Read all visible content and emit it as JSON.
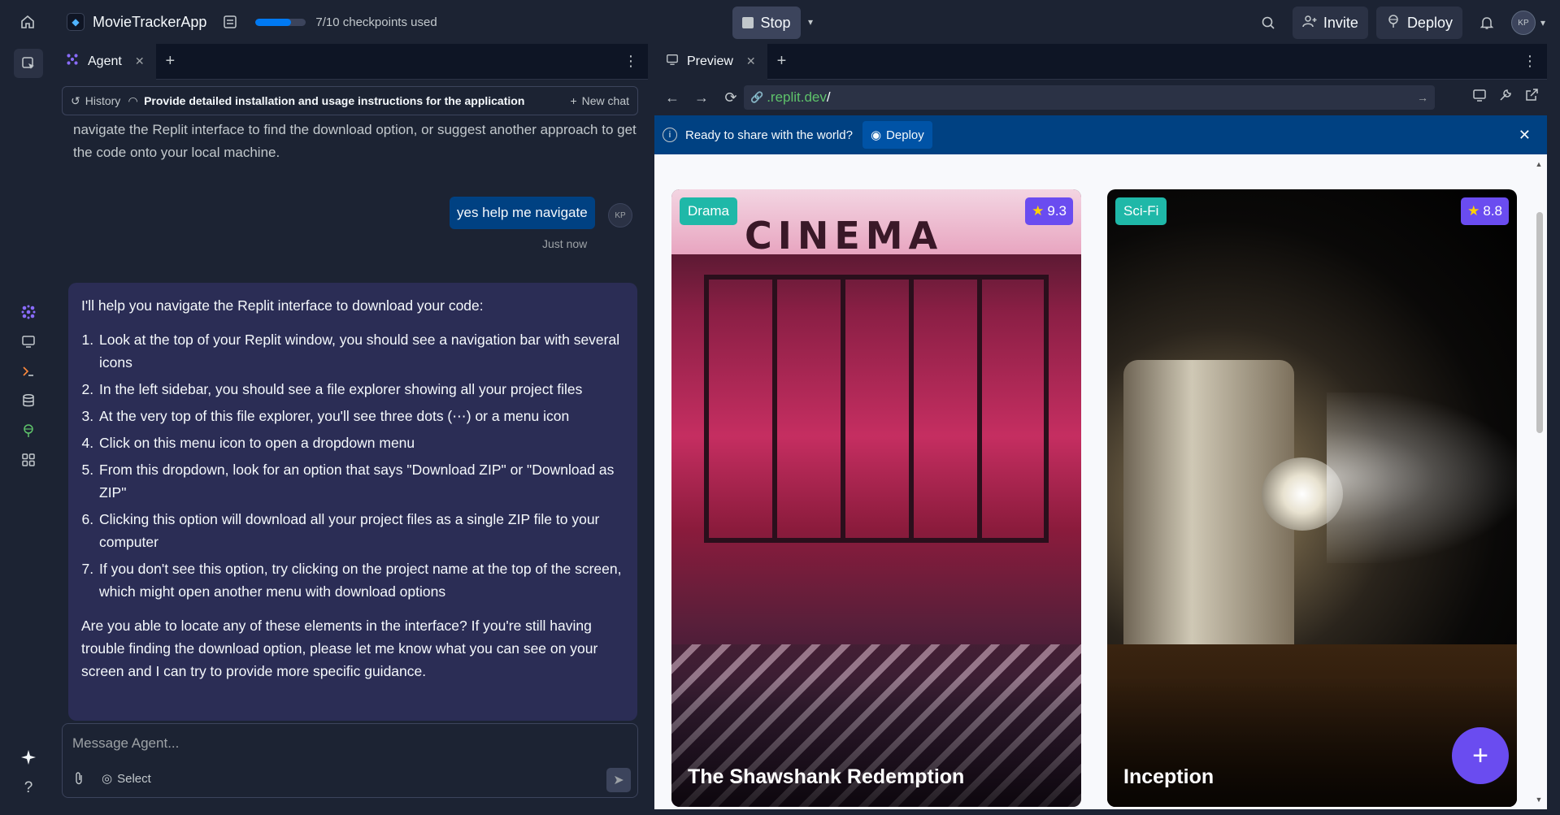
{
  "topbar": {
    "app_name": "MovieTrackerApp",
    "checkpoints_text": "7/10 checkpoints used",
    "checkpoints_progress": 0.7,
    "stop_label": "Stop",
    "invite_label": "Invite",
    "deploy_label": "Deploy",
    "avatar_initials": "KP"
  },
  "agent_panel": {
    "tab_label": "Agent",
    "history_label": "History",
    "chat_title": "Provide detailed installation and usage instructions for the application",
    "new_chat_label": "New chat",
    "prev_message_tail": "navigate the Replit interface to find the download option, or suggest another approach to get the code onto your local machine.",
    "user_message": "yes help me navigate",
    "user_initials": "KP",
    "timestamp": "Just now",
    "agent_intro": "I'll help you navigate the Replit interface to download your code:",
    "steps": [
      "Look at the top of your Replit window, you should see a navigation bar with several icons",
      "In the left sidebar, you should see a file explorer showing all your project files",
      "At the very top of this file explorer, you'll see three dots (⋯) or a menu icon",
      "Click on this menu icon to open a dropdown menu",
      "From this dropdown, look for an option that says \"Download ZIP\" or \"Download as ZIP\"",
      "Clicking this option will download all your project files as a single ZIP file to your computer",
      "If you don't see this option, try clicking on the project name at the top of the screen, which might open another menu with download options"
    ],
    "agent_outro": "Are you able to locate any of these elements in the interface? If you're still having trouble finding the download option, please let me know what you can see on your screen and I can try to provide more specific guidance.",
    "composer_placeholder": "Message Agent...",
    "select_label": "Select"
  },
  "preview_panel": {
    "tab_label": "Preview",
    "url_host": ".replit.dev",
    "url_path": "/",
    "banner_text": "Ready to share with the world?",
    "banner_deploy_label": "Deploy"
  },
  "movies": [
    {
      "title": "The Shawshank Redemption",
      "genre": "Drama",
      "rating": "9.3"
    },
    {
      "title": "Inception",
      "genre": "Sci-Fi",
      "rating": "8.8"
    }
  ],
  "colors": {
    "bg": "#1c2333",
    "accent_blue": "#0079f2",
    "banner_blue": "#004182",
    "agent_bubble": "#2b2d55",
    "genre_teal": "#1fb8a8",
    "rating_purple": "#6a4cf0"
  }
}
